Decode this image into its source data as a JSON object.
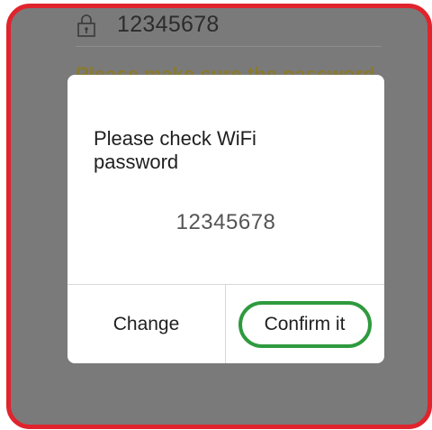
{
  "background": {
    "password_value": "12345678",
    "hint_text": "Please make sure the password"
  },
  "dialog": {
    "title": "Please check WiFi password",
    "password_value": "12345678",
    "buttons": {
      "change_label": "Change",
      "confirm_label": "Confirm it"
    }
  },
  "colors": {
    "frame_border": "#e0242d",
    "overlay": "#7a7a7a",
    "highlight": "#2e9a3e"
  }
}
